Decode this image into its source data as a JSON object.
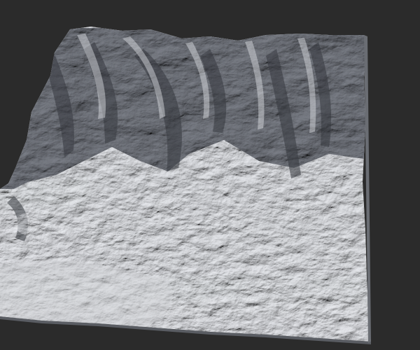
{
  "viewport": {
    "background_color": "#2b2b2b",
    "render_mode": "solid-shaded",
    "object": "terrain-mesh"
  },
  "terrain": {
    "base_color": "#9a9da4",
    "shadow_color": "#3f4248",
    "highlight_color": "#d7d9dd",
    "features": [
      "mountain-ridges",
      "canyons",
      "plateau",
      "lowland-plain"
    ]
  }
}
